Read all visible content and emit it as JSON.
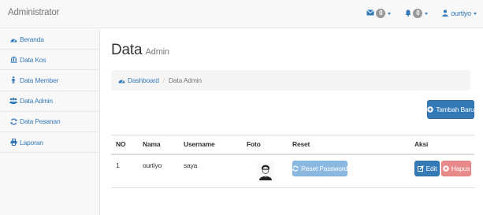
{
  "app": {
    "brand": "Administrator"
  },
  "topnav": {
    "messages_count": "0",
    "alerts_count": "0",
    "user_name": "ourtiyo"
  },
  "sidebar": {
    "items": [
      {
        "label": "Beranda",
        "icon": "dashboard-icon"
      },
      {
        "label": "Data Kos",
        "icon": "bank-icon"
      },
      {
        "label": "Data Member",
        "icon": "user-male-icon"
      },
      {
        "label": "Data Admin",
        "icon": "users-icon"
      },
      {
        "label": "Data Pesanan",
        "icon": "refresh-icon"
      },
      {
        "label": "Laporan",
        "icon": "print-icon"
      }
    ]
  },
  "main": {
    "title": "Data",
    "subtitle": "Admin",
    "breadcrumb": {
      "home": "Dashboard",
      "current": "Data Admin"
    },
    "add_button": "Tambah Baru",
    "table": {
      "headers": [
        "NO",
        "Nama",
        "Username",
        "Foto",
        "Reset",
        "Aksi"
      ],
      "rows": [
        {
          "no": "1",
          "nama": "ourtiyo",
          "username": "saya",
          "reset_label": "Reset Password",
          "edit_label": "Edit",
          "delete_label": "Hapus"
        }
      ]
    }
  },
  "colors": {
    "primary": "#337ab7",
    "primary_light": "#8ab8e0",
    "danger_light": "#e88a8a",
    "navbar_bg": "#f8f8f8"
  }
}
